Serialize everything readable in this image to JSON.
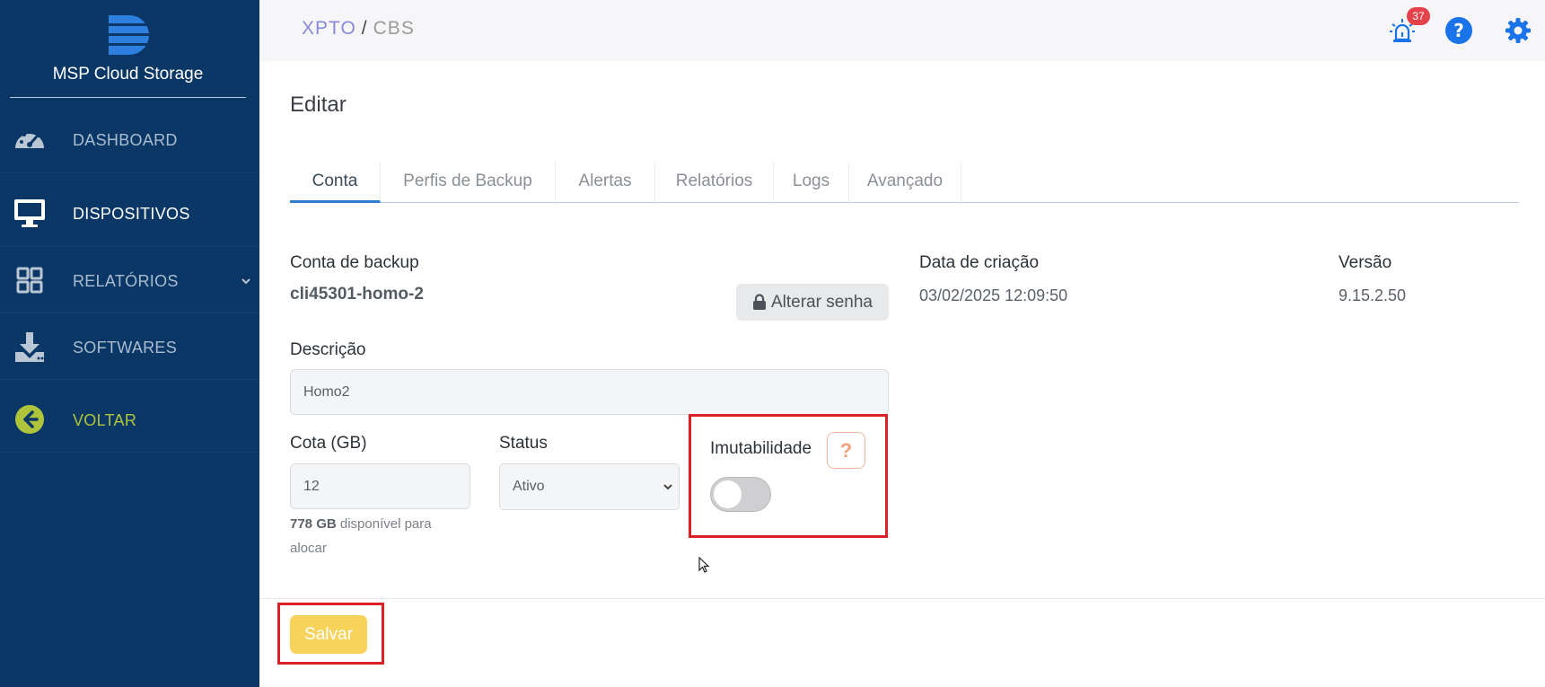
{
  "sidebar": {
    "brand": "MSP Cloud Storage",
    "items": [
      {
        "label": "DASHBOARD",
        "icon": "gauge-icon"
      },
      {
        "label": "DISPOSITIVOS",
        "icon": "monitor-icon"
      },
      {
        "label": "RELATÓRIOS",
        "icon": "grid-icon"
      },
      {
        "label": "SOFTWARES",
        "icon": "download-icon"
      },
      {
        "label": "VOLTAR",
        "icon": "arrow-left-circle-icon"
      }
    ]
  },
  "header": {
    "breadcrumb_parent": "XPTO",
    "breadcrumb_sep": "/",
    "breadcrumb_current": "CBS",
    "alert_count": "37"
  },
  "main": {
    "title": "Editar",
    "tabs": [
      {
        "label": "Conta"
      },
      {
        "label": "Perfis de Backup"
      },
      {
        "label": "Alertas"
      },
      {
        "label": "Relatórios"
      },
      {
        "label": "Logs"
      },
      {
        "label": "Avançado"
      }
    ],
    "account_label": "Conta de backup",
    "account_value": "cli45301-homo-2",
    "change_password": "Alterar senha",
    "created_label": "Data de criação",
    "created_value": "03/02/2025 12:09:50",
    "version_label": "Versão",
    "version_value": "9.15.2.50",
    "description_label": "Descrição",
    "description_value": "Homo2",
    "quota_label": "Cota (GB)",
    "quota_value": "12",
    "quota_available": "778 GB",
    "quota_hint": "disponível para alocar",
    "status_label": "Status",
    "status_value": "Ativo",
    "immutability_label": "Imutabilidade",
    "help_symbol": "?",
    "immutability_on": false,
    "save": "Salvar"
  },
  "colors": {
    "sidebar_bg": "#0b3766",
    "accent_blue": "#2f7fcf",
    "save_button": "#f7d35c",
    "highlight": "#dd1f26",
    "back_green": "#aec43b"
  }
}
